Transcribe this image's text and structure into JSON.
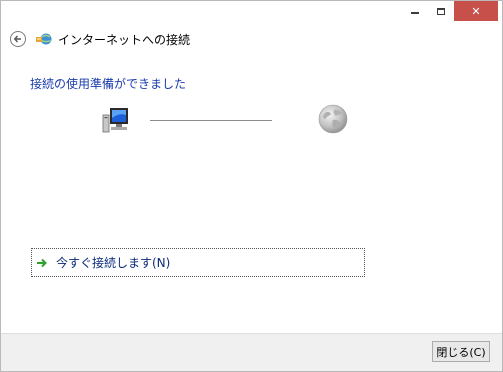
{
  "window": {
    "title": "インターネットへの接続",
    "caption": {
      "minimize_icon": "minimize-icon",
      "maximize_icon": "maximize-icon",
      "close_glyph": "✕"
    }
  },
  "main": {
    "heading": "接続の使用準備ができました",
    "option_label": "今すぐ接続します(N)"
  },
  "footer": {
    "close_label": "閉じる(C)"
  },
  "colors": {
    "heading": "#1a3caa",
    "close_caption": "#c7504b",
    "arrow": "#2ea12e"
  }
}
